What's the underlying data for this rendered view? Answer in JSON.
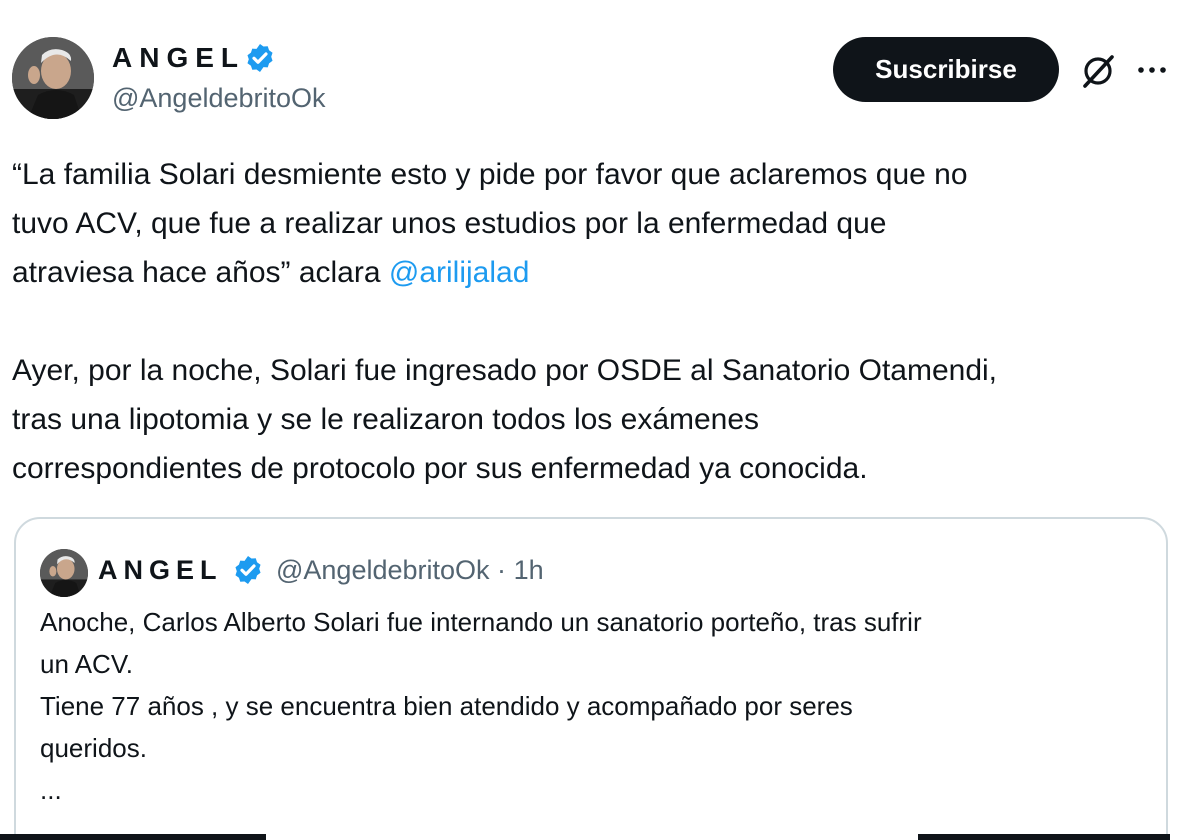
{
  "author": {
    "name": "ANGEL",
    "handle": "@AngeldebritoOk",
    "avatar_icon": "profile-photo",
    "verified_icon": "verified-badge-icon"
  },
  "actions": {
    "subscribe_label": "Suscribirse",
    "grok_icon": "grok-icon",
    "more_icon": "more-dots-icon"
  },
  "tweet": {
    "para1_part1": "“La familia Solari desmiente esto y pide por favor que aclaremos que no",
    "para1_part2": "tuvo ACV, que fue a realizar unos estudios por la enfermedad que",
    "para1_part3": "atraviesa hace años” aclara ",
    "mention": "@arilijalad",
    "para2_line1": "Ayer, por la noche, Solari fue ingresado por OSDE al Sanatorio Otamendi,",
    "para2_line2": "tras una lipotomia y se le realizaron todos los exámenes",
    "para2_line3": "correspondientes de protocolo por sus enfermedad ya conocida."
  },
  "quoted_tweet": {
    "name": "ANGEL",
    "handle": "@AngeldebritoOk",
    "separator": "·",
    "time": "1h",
    "line1": "Anoche, Carlos Alberto Solari fue internando un sanatorio porteño, tras sufrir",
    "line2": "un ACV.",
    "line3": "Tiene 77 años , y se encuentra bien atendido y acompañado por seres",
    "line4": "queridos.",
    "line5": "..."
  },
  "colors": {
    "text": "#0f1419",
    "secondary": "#536471",
    "accent": "#1d9bf0",
    "border": "#cfd9de"
  }
}
